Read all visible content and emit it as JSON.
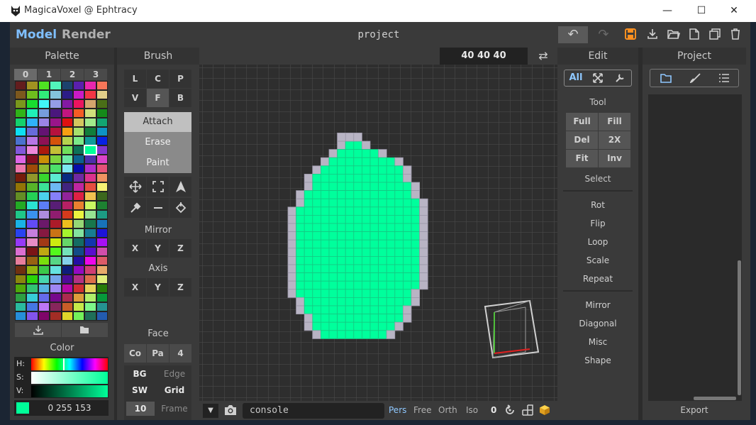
{
  "window": {
    "title": "MagicaVoxel @ Ephtracy",
    "minimize": "—",
    "maximize": "☐",
    "close": "✕"
  },
  "topbar": {
    "mode_model": "Model",
    "mode_render": "Render",
    "project_name": "project",
    "undo_icon": "↶",
    "redo_icon": "↷",
    "save_icon": "💾",
    "import_icon": "⤓",
    "open_icon": "📂",
    "new_icon": "🗋",
    "copy_icon": "⧉",
    "delete_icon": "🗑"
  },
  "palette": {
    "header": "Palette",
    "pages": [
      "0",
      "1",
      "2",
      "3"
    ],
    "color_header": "Color",
    "hsv_labels": [
      "H:",
      "S:",
      "V:"
    ],
    "rgb_value": "0 255 153",
    "current_color": "#00ff99"
  },
  "brush": {
    "header": "Brush",
    "mode_row1": [
      "L",
      "C",
      "P"
    ],
    "mode_row2": [
      "V",
      "F",
      "B"
    ],
    "actions": [
      "Attach",
      "Erase",
      "Paint"
    ],
    "mirror_label": "Mirror",
    "mirror_xyz": [
      "X",
      "Y",
      "Z"
    ],
    "axis_label": "Axis",
    "axis_xyz": [
      "X",
      "Y",
      "Z"
    ],
    "face_label": "Face",
    "face_buttons": [
      "Co",
      "Pa",
      "4"
    ],
    "bg_label": "BG",
    "edge_label": "Edge",
    "sw_label": "SW",
    "grid_label": "Grid",
    "frame_value": "10",
    "frame_label": "Frame"
  },
  "viewport": {
    "dimensions": "40  40  40",
    "swap_icon": "⇄",
    "console_placeholder": "console",
    "views": [
      "Pers",
      "Free",
      "Orth",
      "Iso"
    ],
    "active_view": "Pers",
    "zoom_value": "0",
    "voxel_color": "#00ff9c",
    "outline_color": "#b8b4c4"
  },
  "edit": {
    "header": "Edit",
    "tabs": [
      "All"
    ],
    "tool_label": "Tool",
    "tool_buttons": [
      "Full",
      "Fill",
      "Del",
      "2X",
      "Fit",
      "Inv"
    ],
    "select_label": "Select",
    "group1": [
      "Rot",
      "Flip",
      "Loop",
      "Scale",
      "Repeat"
    ],
    "group2": [
      "Mirror",
      "Diagonal",
      "Misc",
      "Shape"
    ]
  },
  "project": {
    "header": "Project",
    "export_label": "Export"
  }
}
